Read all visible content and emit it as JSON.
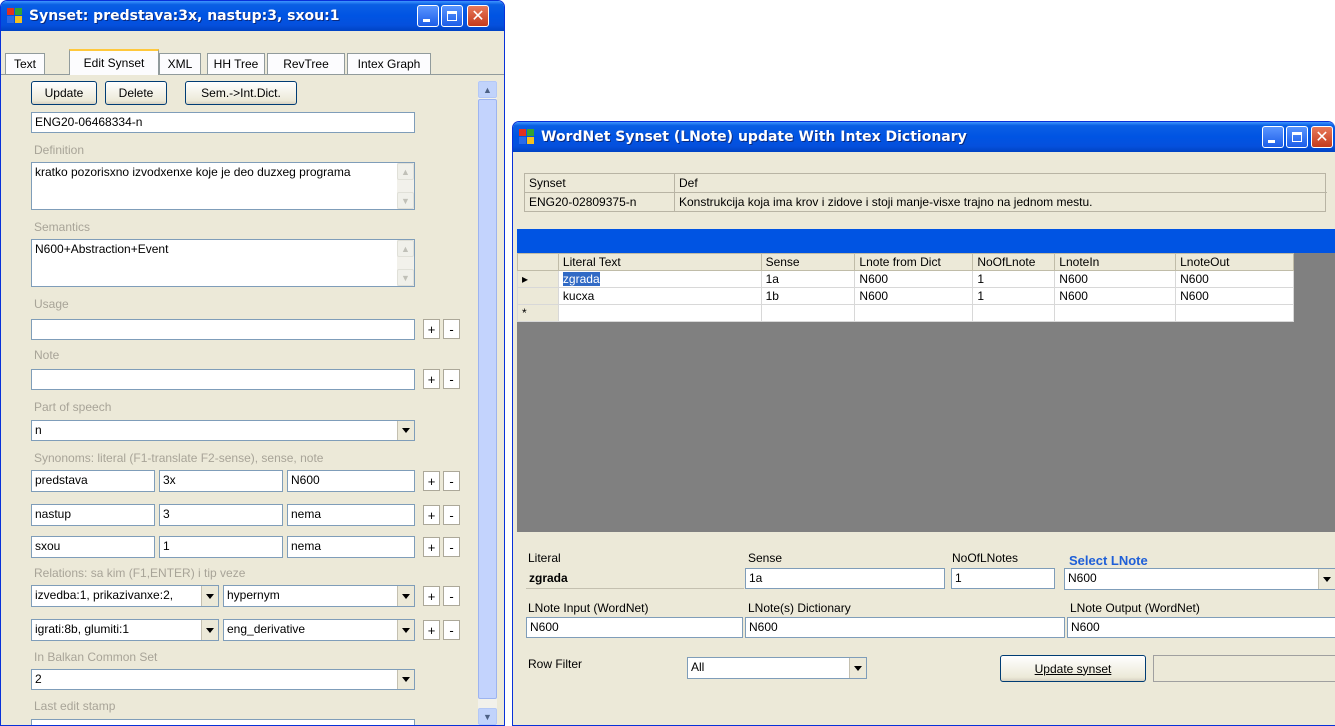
{
  "left_window": {
    "title": "Synset: predstava:3x, nastup:3, sxou:1",
    "tabs": [
      "Text",
      "Edit Synset",
      "XML",
      "HH Tree",
      "RevTree",
      "Intex Graph"
    ],
    "active_tab": "Edit Synset",
    "buttons": {
      "update": "Update",
      "delete": "Delete",
      "sem_to_int": "Sem.->Int.Dict."
    },
    "id_value": "ENG20-06468334-n",
    "definition_label": "Definition",
    "definition_value": "kratko pozorisxno izvodxenxe koje je deo duzxeg programa",
    "semantics_label": "Semantics",
    "semantics_value": "N600+Abstraction+Event",
    "usage_label": "Usage",
    "usage_value": "",
    "note_label": "Note",
    "note_value": "",
    "pos_label": "Part of speech",
    "pos_value": "n",
    "synonyms_label": "Synonoms: literal (F1-translate F2-sense), sense, note",
    "synonyms": [
      {
        "literal": "predstava",
        "sense": "3x",
        "note": "N600"
      },
      {
        "literal": "nastup",
        "sense": "3",
        "note": "nema"
      },
      {
        "literal": "sxou",
        "sense": "1",
        "note": "nema"
      }
    ],
    "relations_label": "Relations: sa kim (F1,ENTER) i tip veze",
    "relations": [
      {
        "target": "izvedba:1, prikazivanxe:2,",
        "type": "hypernym"
      },
      {
        "target": "igrati:8b, glumiti:1",
        "type": "eng_derivative"
      }
    ],
    "bcs_label": "In Balkan Common Set",
    "bcs_value": "2",
    "stamp_label": "Last edit stamp",
    "plus": "+",
    "minus": "-"
  },
  "right_window": {
    "title": "WordNet Synset (LNote) update With Intex Dictionary",
    "synset_header": "Synset",
    "def_header": "Def",
    "synset_value": "ENG20-02809375-n",
    "def_value": "Konstrukcija koja ima krov i zidove i stoji manje-visxe trajno na jednom mestu.",
    "grid": {
      "columns": [
        "Literal Text",
        "Sense",
        "Lnote from Dict",
        "NoOfLnote",
        "LnoteIn",
        "LnoteOut"
      ],
      "rows": [
        [
          "zgrada",
          "1a",
          "N600",
          "1",
          "N600",
          "N600"
        ],
        [
          "kucxa",
          "1b",
          "N600",
          "1",
          "N600",
          "N600"
        ]
      ],
      "new_row_marker": "*",
      "current_row_marker": "▸"
    },
    "detail": {
      "literal_label": "Literal",
      "literal_value": "zgrada",
      "sense_label": "Sense",
      "sense_value": "1a",
      "nooflnotes_label": "NoOfLNotes",
      "nooflnotes_value": "1",
      "select_label": "Select LNote",
      "select_value": "N600",
      "input_label": "LNote Input (WordNet)",
      "input_value": "N600",
      "dict_label": "LNote(s) Dictionary",
      "dict_value": "N600",
      "output_label": "LNote Output (WordNet)",
      "output_value": "N600"
    },
    "row_filter_label": "Row Filter",
    "row_filter_value": "All",
    "update_button": "Update synset"
  },
  "colors": {
    "titlebar": "#0054e3",
    "window_bg": "#ece9d8",
    "grid_bg": "#808080",
    "accent": "#0054e3"
  }
}
